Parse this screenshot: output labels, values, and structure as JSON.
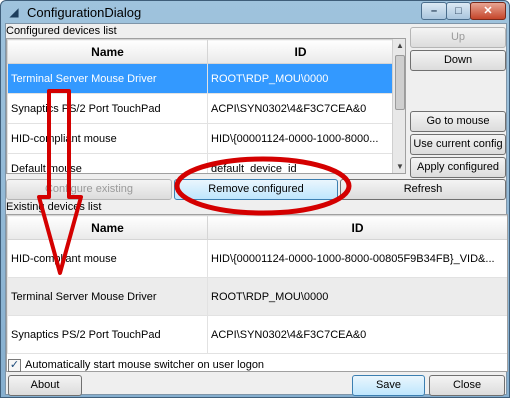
{
  "window": {
    "title": "ConfigurationDialog",
    "controls": {
      "minimize": "–",
      "maximize": "□",
      "close": "✕"
    }
  },
  "configured": {
    "group_label": "Configured devices list",
    "columns": [
      "Name",
      "ID"
    ],
    "rows": [
      {
        "name": "Terminal Server Mouse Driver",
        "id": "ROOT\\RDP_MOU\\0000",
        "selected": true
      },
      {
        "name": "Synaptics PS/2 Port TouchPad",
        "id": "ACPI\\SYN0302\\4&F3C7CEA&0",
        "selected": false
      },
      {
        "name": "HID-compliant mouse",
        "id": "HID\\{00001124-0000-1000-8000...",
        "selected": false
      },
      {
        "name": "Default mouse",
        "id": "default_device_id",
        "selected": false
      }
    ]
  },
  "side_buttons": {
    "up": "Up",
    "down": "Down",
    "go_to_mouse_config": "Go to mouse config",
    "use_current_config": "Use current config",
    "apply_configured": "Apply configured"
  },
  "middle_buttons": {
    "configure_existing": "Configure existing",
    "remove_configured": "Remove configured",
    "refresh": "Refresh"
  },
  "existing": {
    "group_label": "Existing devices list",
    "columns": [
      "Name",
      "ID"
    ],
    "rows": [
      {
        "name": "HID-compliant mouse",
        "id": "HID\\{00001124-0000-1000-8000-00805F9B34FB}_VID&..."
      },
      {
        "name": "Terminal Server Mouse Driver",
        "id": "ROOT\\RDP_MOU\\0000"
      },
      {
        "name": "Synaptics PS/2 Port TouchPad",
        "id": "ACPI\\SYN0302\\4&F3C7CEA&0"
      }
    ]
  },
  "footer": {
    "autostart_label": "Automatically start mouse switcher on user logon",
    "autostart_checked": true,
    "about": "About",
    "save": "Save",
    "close": "Close"
  },
  "colors": {
    "selection": "#3399ff",
    "annotation": "#d40000"
  }
}
